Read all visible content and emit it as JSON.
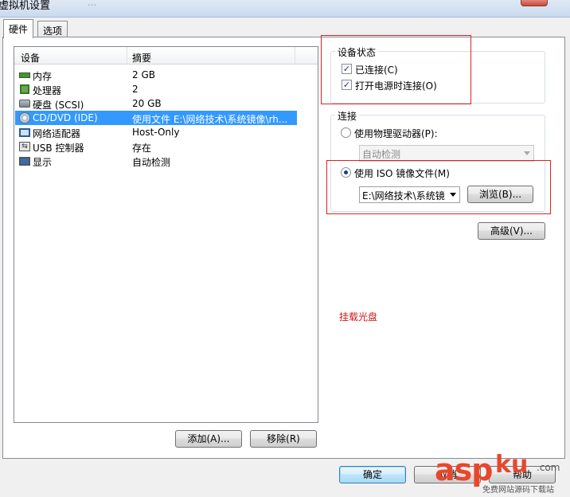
{
  "window": {
    "title": "虚拟机设置",
    "ghost_text": "..."
  },
  "tabs": [
    {
      "label": "硬件"
    },
    {
      "label": "选项"
    }
  ],
  "device_list": {
    "headers": {
      "device": "设备",
      "summary": "摘要"
    },
    "rows": [
      {
        "name": "内存",
        "summary": "2 GB",
        "icon": "memory-icon"
      },
      {
        "name": "处理器",
        "summary": "2",
        "icon": "processor-icon"
      },
      {
        "name": "硬盘 (SCSI)",
        "summary": "20 GB",
        "icon": "harddisk-icon"
      },
      {
        "name": "CD/DVD (IDE)",
        "summary": "使用文件 E:\\网络技术\\系统镜像\\rh...",
        "icon": "cd-dvd-icon",
        "selected": true
      },
      {
        "name": "网络适配器",
        "summary": "Host-Only",
        "icon": "network-adapter-icon"
      },
      {
        "name": "USB 控制器",
        "summary": "存在",
        "icon": "usb-icon"
      },
      {
        "name": "显示",
        "summary": "自动检测",
        "icon": "display-icon"
      }
    ]
  },
  "device_buttons": {
    "add": "添加(A)...",
    "remove": "移除(R)"
  },
  "device_status": {
    "title": "设备状态",
    "connected": {
      "label": "已连接(C)",
      "checked": true
    },
    "connect_on_power": {
      "label": "打开电源时连接(O)",
      "checked": true
    }
  },
  "connection": {
    "title": "连接",
    "physical": {
      "label": "使用物理驱动器(P):",
      "selected": false,
      "combo_value": "自动检测"
    },
    "iso": {
      "label": "使用 ISO 镜像文件(M)",
      "selected": true,
      "combo_value": "E:\\网络技术\\系统镜",
      "browse_label": "浏览(B)..."
    }
  },
  "advanced_label": "高级(V)...",
  "annotation": "挂载光盘",
  "footer": {
    "ok": "确定",
    "cancel": "取消",
    "help": "帮助"
  },
  "watermark": {
    "asp": "asp",
    "ku": "ku",
    "com": ".com",
    "cn": "免费网站源码下载站"
  },
  "colors": {
    "selection": "#3399ff",
    "annotation": "#d01818",
    "highlight_box": "#e02020"
  }
}
